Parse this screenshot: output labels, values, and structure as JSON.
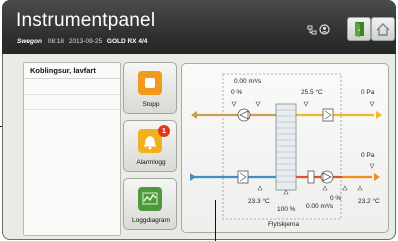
{
  "header": {
    "title": "Instrumentpanel",
    "brand": "Swegon",
    "time": "08:18",
    "date": "2013-09-25",
    "unit": "GOLD RX",
    "page": "4/4"
  },
  "sidebar": {
    "items": [
      {
        "label": "Koblingsur, lavfart"
      }
    ]
  },
  "buttons": {
    "stop_label": "Stopp",
    "alarm_label": "Alarmlogg",
    "alarm_count": "1",
    "log_label": "Loggdiagram"
  },
  "flow": {
    "caption": "Flytskjema",
    "top": {
      "flow_left": "0.00 m³/s",
      "pct_left": "0 %",
      "temp": "25.5 °C",
      "pressure": "0 Pa"
    },
    "bottom": {
      "pressure": "0 Pa",
      "temp_left": "23.3 °C",
      "rotor_pct": "100 %",
      "flow_right": "0.00 m³/s",
      "pct_right": "0 %",
      "temp_right": "23.2 °C"
    }
  },
  "colors": {
    "header": "#2d2f2e",
    "extract_warm": "#c9a050",
    "extract_yellow": "#f0b823",
    "supply_blue": "#3d8fc4",
    "supply_red": "#e0502a",
    "supply_orange": "#f08b1e",
    "stop_icon": "#f29a1e",
    "alarm_icon": "#f2b020",
    "log_icon": "#4c9a3a",
    "badge": "#e03a1e"
  },
  "icons": {
    "fan": "fan-icon",
    "filter": "filter-icon",
    "heater": "heater-coil-icon",
    "rotor": "heat-exchanger-icon",
    "door": "door-icon",
    "home": "home-icon",
    "network": "network-icon",
    "user": "user-icon"
  }
}
